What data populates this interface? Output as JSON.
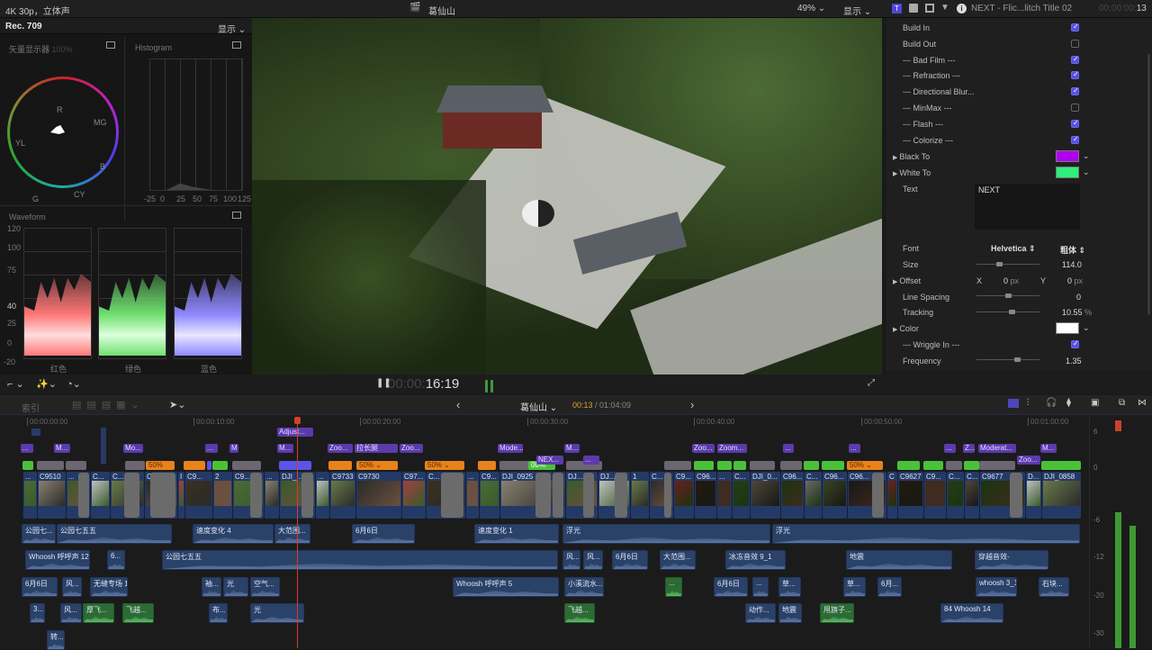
{
  "topbar": {
    "format": "4K 30p，立体声",
    "project": "葛仙山",
    "zoom": "49% ⌄",
    "display": "显示 ⌄"
  },
  "scopes": {
    "standard": "Rec. 709",
    "display": "显示 ⌄",
    "vectorscope": "矢量显示器",
    "vectorscope_pct": "100%",
    "histogram": "Histogram",
    "vector_targets": [
      "R",
      "MG",
      "B",
      "CY",
      "G",
      "YL"
    ],
    "hist_ticks": [
      "-25",
      "0",
      "25",
      "50",
      "75",
      "100",
      "125"
    ],
    "waveform": "Waveform",
    "wave_ticks": [
      "120",
      "100",
      "75",
      "40",
      "25",
      "0",
      "-20"
    ],
    "channels": [
      "红色",
      "绿色",
      "蓝色"
    ]
  },
  "inspector": {
    "clip_name": "NEXT - Flic...litch Title 02",
    "timecode_dim": "00:00:00:",
    "timecode_frame": "13",
    "checks": [
      {
        "label": "Build In",
        "checked": true
      },
      {
        "label": "Build Out",
        "checked": false
      },
      {
        "label": "--- Bad Film ---",
        "checked": true
      },
      {
        "label": "--- Refraction ---",
        "checked": true
      },
      {
        "label": "--- Directional Blur...",
        "checked": true
      },
      {
        "label": "--- MinMax ---",
        "checked": false
      },
      {
        "label": "--- Flash ---",
        "checked": true
      },
      {
        "label": "--- Colorize ---",
        "checked": true
      }
    ],
    "black_to": {
      "label": "Black To",
      "color": "#b000f0"
    },
    "white_to": {
      "label": "White To",
      "color": "#2ef07a"
    },
    "text_label": "Text",
    "text_value": "NEXT",
    "font_label": "Font",
    "font": "Helvetica ⇕",
    "weight": "粗体 ⇕",
    "size_label": "Size",
    "size": "114.0",
    "offset_label": "Offset",
    "offset_x_label": "X",
    "offset_x": "0",
    "offset_y_label": "Y",
    "offset_y": "0",
    "px": "px",
    "line_spacing_label": "Line Spacing",
    "line_spacing": "0",
    "tracking_label": "Tracking",
    "tracking": "10.55",
    "pct": "%",
    "color_label": "Color",
    "color": "#ffffff",
    "wriggle_label": "--- Wriggle In ---",
    "wriggle_checked": true,
    "frequency_label": "Frequency",
    "frequency": "1.35"
  },
  "viewer_controls": {
    "timecode_dim": "00:00:",
    "timecode": "16:19"
  },
  "timeline_toolbar": {
    "index": "索引",
    "project": "葛仙山 ⌄",
    "position": "00:13",
    "duration": " / 01:04:09",
    "prev": "‹",
    "next": "›"
  },
  "ruler": [
    "00:00:00:00",
    "00:00:10:00",
    "00:00:20:00",
    "00:00:30:00",
    "00:00:40:00",
    "00:00:50:00",
    "00:01:00:00"
  ],
  "titles_top": [
    "Adjust..."
  ],
  "titles": [
    "...",
    "M...",
    "Mo...",
    "...",
    "M",
    "M...",
    "Zoo...",
    "拉长腿",
    "Zoo...",
    "Mode...",
    "M...",
    "Zoo...",
    "Zoom...",
    "...",
    "...",
    "...",
    "Z...",
    "Moderat...",
    "M..."
  ],
  "titles2": [
    "NEX...",
    "...",
    "Zoo..."
  ],
  "fx_labels": [
    "50%",
    "50% ⌄",
    "50% ⌄",
    "00%",
    "50% ⌄"
  ],
  "video_clips": [
    "...",
    "C9510",
    "...",
    "C...",
    "C...",
    "C",
    "I",
    "C9...",
    "2",
    "C9...",
    "...",
    "DJI_...",
    "...",
    "C9733",
    "C9730",
    "C97...",
    "C...",
    "...",
    "C9...",
    "DJI_0925",
    "DJ...",
    "DJ...",
    "1",
    "C...",
    "C9...",
    "C96...",
    "...",
    "C...",
    "DJI_0...",
    "C96...",
    "C...",
    "C96...",
    "C96...",
    "C",
    "C9627",
    "C9...",
    "C...",
    "C...",
    "C9677",
    "D...",
    "DJI_0858"
  ],
  "audio": [
    [
      "公园七...",
      "公园七五五",
      "速度变化 4",
      "大范围...",
      "6月6日",
      "速度变化 1",
      "浮光",
      "浮光"
    ],
    [
      "Whoosh 呼呼声 12",
      "6...",
      "公园七五五",
      "风...",
      "风...",
      "6月6日",
      "大范围...",
      "冰冻音效 9_1",
      "地震",
      "穿越音效-"
    ],
    [
      "6月6日",
      "风...",
      "无缝专场 1",
      "袖...",
      "光",
      "空气...",
      "Whoosh 呼呼声 5",
      "小溪流水...",
      "...",
      "6月6日",
      "...",
      "草...",
      "草...",
      "6月...",
      "whoosh 3_1",
      "石块..."
    ],
    [
      "3...",
      "风...",
      "厚飞...",
      "飞越...",
      "布...",
      "光",
      "飞越...",
      "动作...",
      "地震",
      "甩旗子...",
      "84 Whoosh 14"
    ],
    [
      "转..."
    ]
  ],
  "meter_ticks": [
    "6",
    "0",
    "-6",
    "-12",
    "-20",
    "-30"
  ],
  "colors": {
    "accent": "#5a4fe0",
    "playhead": "#d0402a",
    "title_clip": "#5b3bab",
    "video_clip": "#243a66",
    "audio_clip": "#2a4168",
    "effect_orange": "#e8821a",
    "effect_green": "#49c23a"
  }
}
